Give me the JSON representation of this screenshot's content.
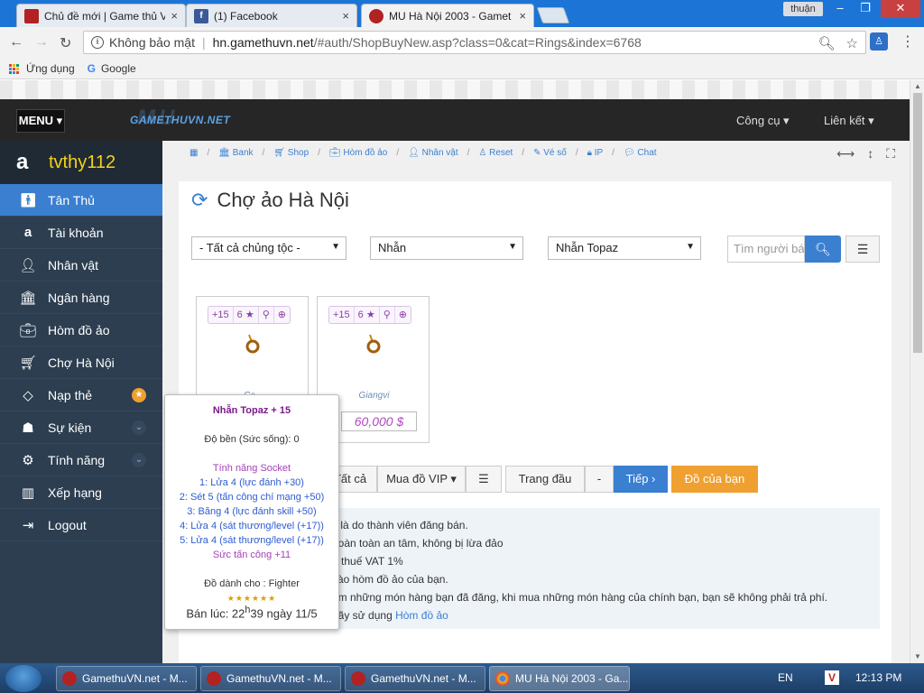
{
  "browser": {
    "tabs": [
      {
        "title": "Chủ đề mới | Game thủ V",
        "close": "×"
      },
      {
        "title": "(1) Facebook",
        "close": "×"
      },
      {
        "title": "MU Hà Nội 2003 - Gamet",
        "close": "×"
      }
    ],
    "user_label": "thuận",
    "address": {
      "security": "Không bảo mật",
      "separator": "|",
      "host": "hn.gamethuvn.net",
      "path": "/#auth/ShopBuyNew.asp?class=0&cat=Rings&index=6768"
    },
    "bookmarks": {
      "apps": "Ứng dụng",
      "google": "Google"
    }
  },
  "site": {
    "menu_label": "MENU ▾",
    "logo_text": "GAMETHUVN.NET",
    "logo_bg": "MU",
    "nav": [
      "Công cụ ▾",
      "Liên kết ▾"
    ]
  },
  "sidebar": {
    "username": "tvthy112",
    "items": [
      {
        "label": "Tân Thủ",
        "icon": "person-icon"
      },
      {
        "label": "Tài khoản",
        "icon": "amazon-icon"
      },
      {
        "label": "Nhân vật",
        "icon": "user-icon"
      },
      {
        "label": "Ngân hàng",
        "icon": "bank-icon"
      },
      {
        "label": "Hòm đồ ảo",
        "icon": "suitcase-icon"
      },
      {
        "label": "Chợ Hà Nội",
        "icon": "cart-icon"
      },
      {
        "label": "Nạp thẻ",
        "icon": "diamond-icon"
      },
      {
        "label": "Sự kiện",
        "icon": "android-icon"
      },
      {
        "label": "Tính năng",
        "icon": "cogs-icon"
      },
      {
        "label": "Xếp hạng",
        "icon": "bar-chart-icon"
      },
      {
        "label": "Logout",
        "icon": "logout-icon"
      }
    ]
  },
  "breadcrumbs": [
    "Bank",
    "Shop",
    "Hòm đồ ảo",
    "Nhân vật",
    "Reset",
    "Vé số",
    "IP",
    "Chat"
  ],
  "page": {
    "title": "Chợ ảo Hà Nội",
    "filters": {
      "race": "- Tất cả chủng tộc -",
      "category": "Nhẫn",
      "item": "Nhẫn Topaz",
      "search_placeholder": "Tìm người bán"
    },
    "items": [
      {
        "tools": [
          "+15",
          "6 ★",
          "🔍",
          "🔍"
        ],
        "seller": "Gs...",
        "price": ""
      },
      {
        "tools": [
          "+15",
          "6 ★",
          "🔍",
          "🔍"
        ],
        "seller": "Giangvi",
        "price": "60,000 $"
      }
    ],
    "buttons": {
      "all": "Tất cả",
      "vip": "Mua đồ VIP ▾",
      "first": "Trang đầu",
      "dash": "-",
      "next": "Tiếp ›",
      "mine": "Đồ của bạn"
    },
    "notice": [
      "y là do thành viên đăng bán.",
      "hoàn toàn an tâm, không bị lừa đảo",
      "u thuế VAT 1%",
      "vào hòm đồ ảo của bạn.",
      "em những món hàng bạn đã đăng, khi mua những món hàng của chính bạn, bạn sẽ không phải trả phí.",
      "hãy sử dụng"
    ],
    "notice_link": "Hòm đồ ảo"
  },
  "tooltip": {
    "name": "Nhẫn Topaz + 15",
    "durability": "Độ bền (Sức sống): 0",
    "socket_title": "Tính năng Socket",
    "sockets": [
      "1: Lửa 4 (lực đánh +30)",
      "2: Sét 5 (tấn công chí mạng +50)",
      "3: Băng 4 (lực đánh skill +50)",
      "4: Lửa 4 (sát thương/level (+17))",
      "5: Lửa 4 (sát thương/level (+17))"
    ],
    "bonus": "Sức tấn công +11",
    "class": "Đồ dành cho : Fighter",
    "stars": "★★★★★★",
    "sold_prefix": "Bán lúc: 22",
    "sold_sup": "h",
    "sold_suffix": "39 ngày 11/5"
  },
  "taskbar": {
    "tasks": [
      "GamethuVN.net - M...",
      "GamethuVN.net - M...",
      "GamethuVN.net - M...",
      "MU Hà Nội 2003 - Ga..."
    ],
    "lang": "EN",
    "tray_v": "V",
    "time": "12:13 PM"
  },
  "colors": {
    "accent": "#3a7fd0",
    "sidebar": "#2c3e50",
    "orange": "#f0a030",
    "title_bar": "#1c75d6"
  }
}
